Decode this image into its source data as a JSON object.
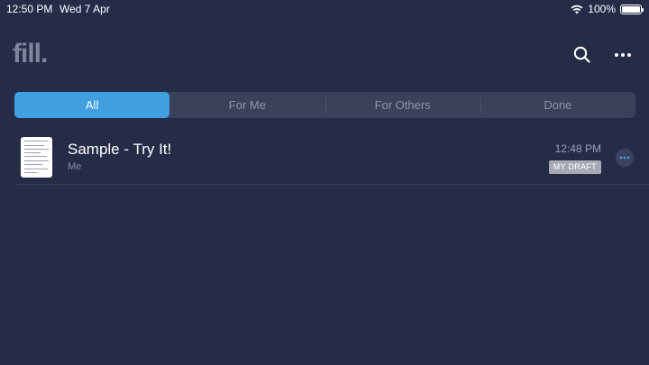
{
  "status_bar": {
    "time": "12:50 PM",
    "date": "Wed 7 Apr",
    "battery": "100%",
    "battery_level": 1.0,
    "icons": [
      "wifi-icon",
      "battery-icon"
    ]
  },
  "header": {
    "logo": "fill.",
    "actions": [
      "search-icon",
      "more-icon"
    ]
  },
  "tabs": [
    {
      "label": "All",
      "active": true
    },
    {
      "label": "For Me",
      "active": false
    },
    {
      "label": "For Others",
      "active": false
    },
    {
      "label": "Done",
      "active": false
    }
  ],
  "documents": [
    {
      "title": "Sample - Try It!",
      "owner": "Me",
      "time": "12:48 PM",
      "status": "MY DRAFT",
      "icon": "document-thumbnail"
    }
  ],
  "colors": {
    "background": "#252c48",
    "accent": "#3f9fdf",
    "badge": "#a7aab3"
  }
}
